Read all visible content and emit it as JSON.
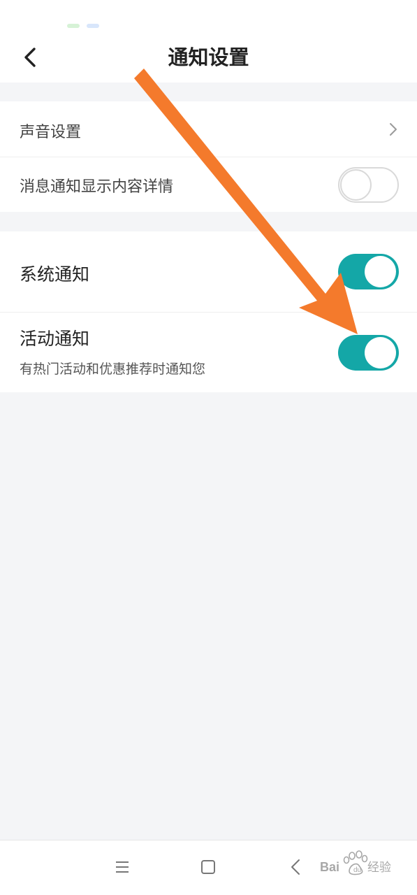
{
  "header": {
    "title": "通知设置",
    "back_icon": "chevron-left-icon"
  },
  "settings": {
    "sound": {
      "label": "声音设置",
      "icon": "chevron-right-icon"
    },
    "detail": {
      "label": "消息通知显示内容详情",
      "enabled": false
    },
    "system": {
      "label": "系统通知",
      "enabled": true
    },
    "activity": {
      "label": "活动通知",
      "description": "有热门活动和优惠推荐时通知您",
      "enabled": true
    }
  },
  "nav": {
    "menu_icon": "menu-icon",
    "home_icon": "square-home-icon",
    "back_icon": "triangle-back-icon"
  },
  "colors": {
    "toggle_on": "#14a7a7",
    "toggle_off": "#ffffff",
    "arrow": "#f47a2c",
    "background": "#f4f5f7"
  },
  "watermark": "Bai du 经验"
}
